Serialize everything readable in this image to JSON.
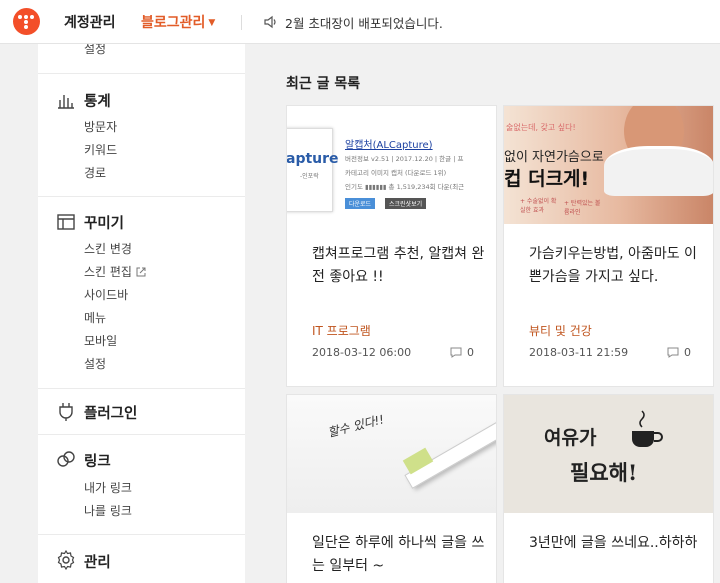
{
  "header": {
    "account_label": "계정관리",
    "blog_label": "블로그관리",
    "notice": "2월 초대장이 배포되었습니다."
  },
  "sidebar": {
    "cut_item": "설정",
    "sections": [
      {
        "title": "통계",
        "icon": "bar-chart-icon",
        "items": [
          "방문자",
          "키워드",
          "경로"
        ]
      },
      {
        "title": "꾸미기",
        "icon": "layout-icon",
        "items": [
          "스킨 변경",
          "스킨 편집",
          "사이드바",
          "메뉴",
          "모바일",
          "설정"
        ]
      },
      {
        "title": "플러그인",
        "icon": "plug-icon",
        "items": []
      },
      {
        "title": "링크",
        "icon": "link-icon",
        "items": [
          "내가 링크",
          "나를 링크"
        ]
      },
      {
        "title": "관리",
        "icon": "gear-icon",
        "items": []
      }
    ]
  },
  "main": {
    "title": "최근 글 목록",
    "posts": [
      {
        "title": "캡쳐프로그램 추천, 알캡쳐 완전 좋아요 !!",
        "category": "IT 프로그램",
        "date": "2018-03-12 06:00",
        "comments": "0",
        "thumb": {
          "app_name": "알캡처(ALCapture)",
          "version": "버전정보  v2.51  |  2017.12.20  |  한글  |  프",
          "category_line": "카테고리  이미지 캡처 (다운로드 1위)",
          "popularity": "인기도 ▮▮▮▮▮▮  총 1,519,234회 다운(최근",
          "logo_text": "apture",
          "logo_sub": "-인포락",
          "btn_download": "다운로드",
          "btn_screenshot": "스크린샷보기"
        }
      },
      {
        "title": "가슴키우는방법, 아줌마도 이쁜가슴을 가지고 싶다.",
        "category": "뷰티 및 건강",
        "date": "2018-03-11 21:59",
        "comments": "0",
        "thumb": {
          "line1": "없이 자연가슴으로",
          "line2": "컵 더크게!",
          "top_text": "술없는데, 갖고 싶다!",
          "tag1": "+ 탄력있는 볼륨라인",
          "tag2": "+ 수술없이 확실한 효과"
        }
      },
      {
        "title": "일단은 하루에 하나씩 글을 쓰는 일부터 ~",
        "category": "",
        "date": "",
        "comments": "",
        "thumb": {
          "handwriting": "할수 있다!!"
        }
      },
      {
        "title": "3년만에 글을 쓰네요..하하하",
        "category": "",
        "date": "",
        "comments": "",
        "thumb": {
          "line1": "여유가",
          "line2": "필요해!"
        }
      }
    ]
  },
  "colors": {
    "brand": "#f34f29",
    "accent": "#e25c28",
    "category": "#c0551f"
  }
}
